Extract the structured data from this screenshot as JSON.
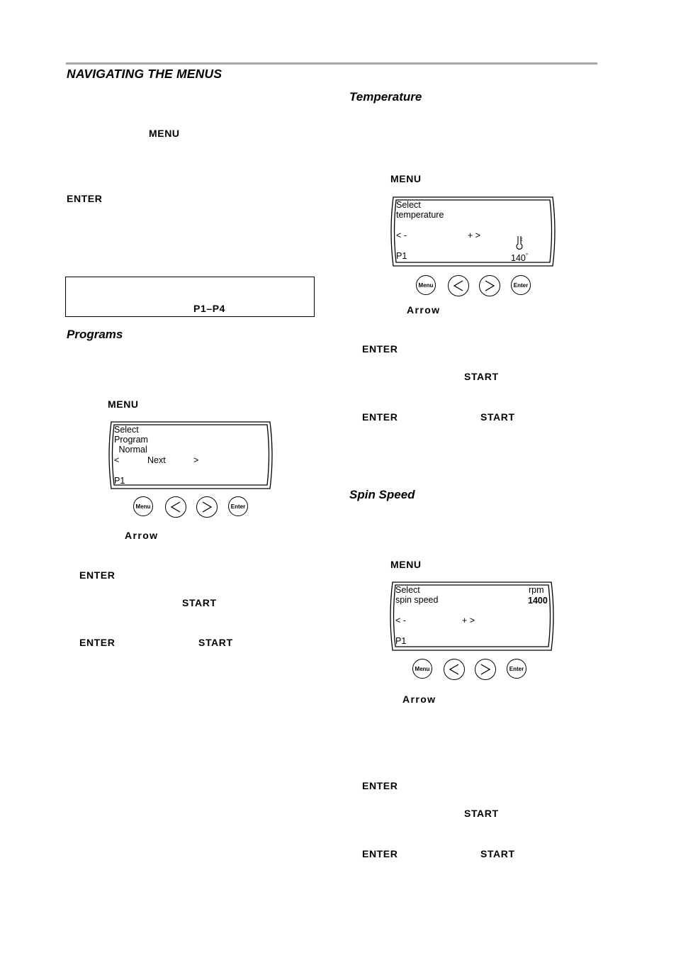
{
  "page": {
    "title": "NAVIGATING THE MENUS",
    "left_column": {
      "menu_keyword": "MENU",
      "enter_keyword": "ENTER",
      "note_box": {
        "text": "P1–P4"
      },
      "programs": {
        "heading": "Programs",
        "menu_keyword": "MENU",
        "display": {
          "line1": "Select",
          "line2": "Program",
          "line3": " Normal",
          "nav_left": "<",
          "nav_center": "Next",
          "nav_right": ">",
          "program_slot": "P1"
        },
        "arrow_keyword": "Arrow",
        "enter_keyword_1": "ENTER",
        "start_keyword_1": "START",
        "enter_keyword_2": "ENTER",
        "start_keyword_2": "START"
      }
    },
    "right_column": {
      "temperature": {
        "heading": "Temperature",
        "menu_keyword": "MENU",
        "display": {
          "line1": "Select",
          "line2": "temperature",
          "minus": "< -",
          "plus": "+ >",
          "icon": "thermometer-icon",
          "value": "140",
          "unit": "°",
          "program_slot": "P1"
        },
        "arrow_keyword": "Arrow",
        "enter_keyword_1": "ENTER",
        "start_keyword_1": "START",
        "enter_keyword_2": "ENTER",
        "start_keyword_2": "START"
      },
      "spin_speed": {
        "heading": "Spin Speed",
        "menu_keyword": "MENU",
        "display": {
          "line1": "Select",
          "line2": "spin speed",
          "unit": "rpm",
          "value": "1400",
          "minus": "< -",
          "plus": "+ >",
          "program_slot": "P1"
        },
        "arrow_keyword": "Arrow",
        "enter_keyword_1": "ENTER",
        "start_keyword_1": "START",
        "enter_keyword_2": "ENTER",
        "start_keyword_2": "START"
      }
    },
    "control_buttons": {
      "menu": "Menu",
      "left": "left-arrow-icon",
      "right": "right-arrow-icon",
      "enter": "Enter"
    }
  }
}
